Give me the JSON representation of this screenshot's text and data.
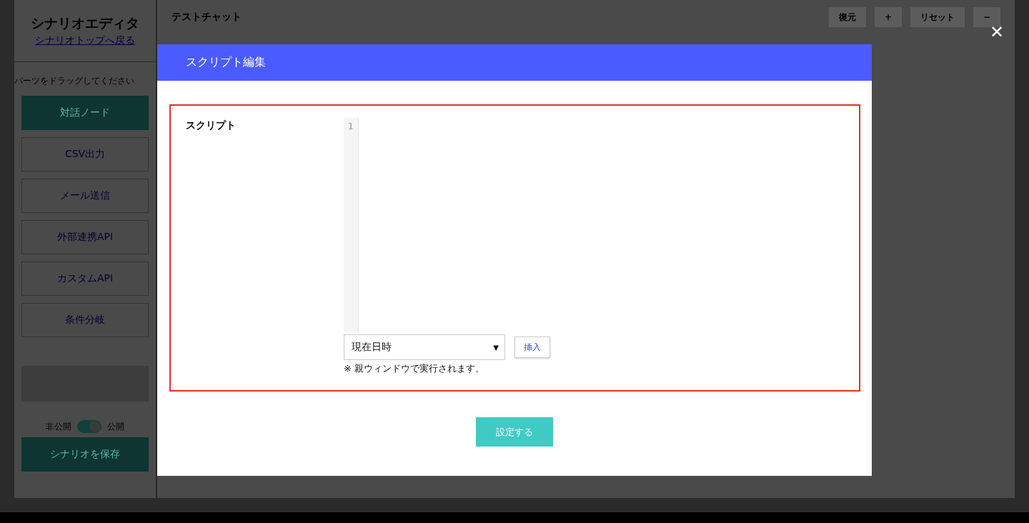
{
  "sidebar": {
    "title": "シナリオエディタ",
    "back_link": "シナリオトップへ戻る",
    "hint": "パーツをドラッグしてください",
    "parts": [
      {
        "label": "対話ノード",
        "kind": "primary"
      },
      {
        "label": "CSV出力",
        "kind": "outline"
      },
      {
        "label": "メール送信",
        "kind": "outline"
      },
      {
        "label": "外部連携API",
        "kind": "outline"
      },
      {
        "label": "カスタムAPI",
        "kind": "outline"
      },
      {
        "label": "条件分岐",
        "kind": "outline"
      }
    ],
    "toggle": {
      "off_label": "非公開",
      "on_label": "公開",
      "on": true
    },
    "save_button": "シナリオを保存"
  },
  "main": {
    "title": "テストチャット",
    "toolbar": [
      "復元",
      "+",
      "リセット",
      "−"
    ]
  },
  "modal": {
    "title": "スクリプト編集",
    "close": "✕",
    "field_label": "スクリプト",
    "line_numbers": [
      "1"
    ],
    "select_value": "現在日時",
    "select_caret": "▼",
    "insert_button": "挿入",
    "note": "※ 親ウィンドウで実行されます。",
    "submit": "設定する"
  }
}
